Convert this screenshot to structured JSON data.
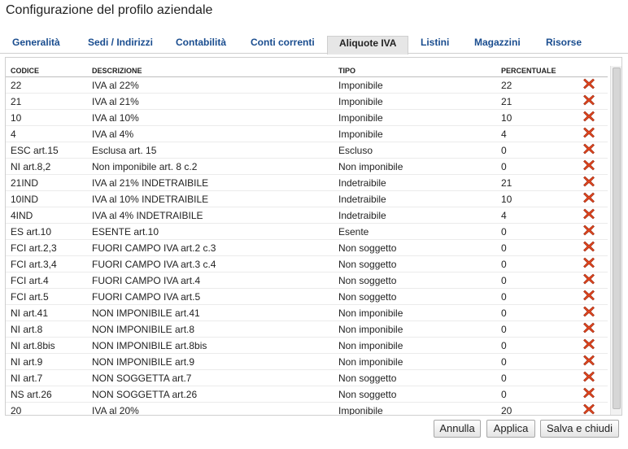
{
  "window": {
    "title": "Configurazione del profilo aziendale"
  },
  "tabs": [
    {
      "label": "Generalità"
    },
    {
      "label": "Sedi / Indirizzi"
    },
    {
      "label": "Contabilità"
    },
    {
      "label": "Conti correnti"
    },
    {
      "label": "Aliquote IVA"
    },
    {
      "label": "Listini"
    },
    {
      "label": "Magazzini"
    },
    {
      "label": "Risorse"
    }
  ],
  "grid": {
    "columns": {
      "code": "CODICE",
      "description": "DESCRIZIONE",
      "type": "TIPO",
      "percent": "PERCENTUALE"
    },
    "delete_icon": "delete-x-icon",
    "delete_color": "#e0451f",
    "rows": [
      {
        "code": "22",
        "description": "IVA al 22%",
        "type": "Imponibile",
        "percent": "22"
      },
      {
        "code": "21",
        "description": "IVA al 21%",
        "type": "Imponibile",
        "percent": "21"
      },
      {
        "code": "10",
        "description": "IVA al 10%",
        "type": "Imponibile",
        "percent": "10"
      },
      {
        "code": "4",
        "description": "IVA al 4%",
        "type": "Imponibile",
        "percent": "4"
      },
      {
        "code": "ESC art.15",
        "description": "Esclusa art. 15",
        "type": "Escluso",
        "percent": "0"
      },
      {
        "code": "NI art.8,2",
        "description": "Non imponibile art. 8 c.2",
        "type": "Non imponibile",
        "percent": "0"
      },
      {
        "code": "21IND",
        "description": "IVA al 21% INDETRAIBILE",
        "type": "Indetraibile",
        "percent": "21"
      },
      {
        "code": "10IND",
        "description": "IVA al 10% INDETRAIBILE",
        "type": "Indetraibile",
        "percent": "10"
      },
      {
        "code": "4IND",
        "description": "IVA al 4% INDETRAIBILE",
        "type": "Indetraibile",
        "percent": "4"
      },
      {
        "code": "ES art.10",
        "description": "ESENTE art.10",
        "type": "Esente",
        "percent": "0"
      },
      {
        "code": "FCI art.2,3",
        "description": "FUORI CAMPO IVA art.2 c.3",
        "type": "Non soggetto",
        "percent": "0"
      },
      {
        "code": "FCI art.3,4",
        "description": "FUORI CAMPO IVA art.3 c.4",
        "type": "Non soggetto",
        "percent": "0"
      },
      {
        "code": "FCI art.4",
        "description": "FUORI CAMPO IVA art.4",
        "type": "Non soggetto",
        "percent": "0"
      },
      {
        "code": "FCI art.5",
        "description": "FUORI CAMPO IVA art.5",
        "type": "Non soggetto",
        "percent": "0"
      },
      {
        "code": "NI art.41",
        "description": "NON IMPONIBILE art.41",
        "type": "Non imponibile",
        "percent": "0"
      },
      {
        "code": "NI art.8",
        "description": "NON IMPONIBILE art.8",
        "type": "Non imponibile",
        "percent": "0"
      },
      {
        "code": "NI art.8bis",
        "description": "NON IMPONIBILE art.8bis",
        "type": "Non imponibile",
        "percent": "0"
      },
      {
        "code": "NI art.9",
        "description": "NON IMPONIBILE art.9",
        "type": "Non imponibile",
        "percent": "0"
      },
      {
        "code": "NI art.7",
        "description": "NON SOGGETTA art.7",
        "type": "Non soggetto",
        "percent": "0"
      },
      {
        "code": "NS art.26",
        "description": "NON SOGGETTA art.26",
        "type": "Non soggetto",
        "percent": "0"
      },
      {
        "code": "20",
        "description": "IVA al 20%",
        "type": "Imponibile",
        "percent": "20"
      }
    ]
  },
  "buttons": {
    "cancel": "Annulla",
    "apply": "Applica",
    "save_close": "Salva e chiudi"
  }
}
